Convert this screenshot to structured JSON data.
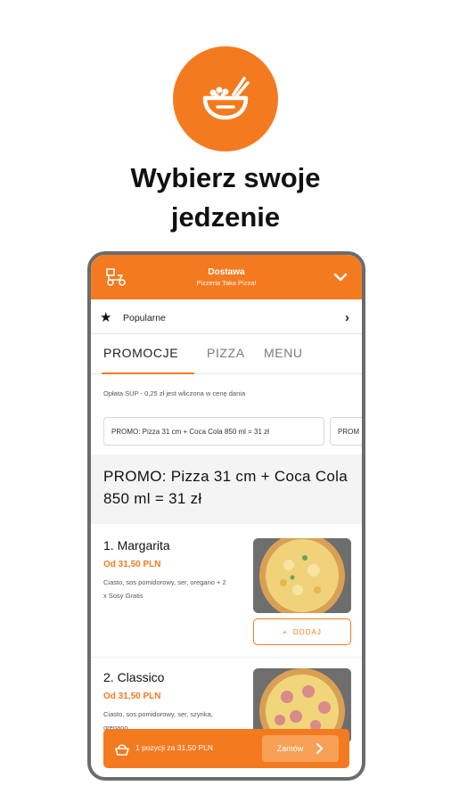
{
  "headline": {
    "line1": "Wybierz swoje",
    "line2": "jedzenie"
  },
  "colors": {
    "accent": "#F47A20"
  },
  "app": {
    "topbar": {
      "title": "Dostawa",
      "subtitle": "Pizzeria Taka Pizza!",
      "left_icon": "delivery-scooter-icon",
      "right_icon": "chevron-down-icon"
    },
    "popular": {
      "label": "Popularne",
      "icon": "star-icon",
      "arrow": "›"
    },
    "tabs": [
      {
        "label": "PROMOCJE",
        "active": true
      },
      {
        "label": "PIZZA",
        "active": false
      },
      {
        "label": "MENU",
        "active": false
      }
    ],
    "note": "Opłata SUP - 0,25 zł jest wliczona w cenę dania",
    "chips": [
      "PROMO: Pizza 31 cm + Coca Cola 850 ml = 31 zł",
      "PROM"
    ],
    "section_title": "PROMO: Pizza 31 cm + Coca Cola 850 ml = 31 zł",
    "items": [
      {
        "name": "1. Margarita",
        "price": "Od 31,50 PLN",
        "desc": "Ciasto, sos pomidorowy, ser, oregano + 2 x Sosy Gratis",
        "add_label": "DODAJ"
      },
      {
        "name": "2. Classico",
        "price": "Od 31,50 PLN",
        "desc": "Ciasto, sos pomidorowy, ser, szynka, oregano"
      }
    ],
    "cart": {
      "summary": "1 pozycji za 31,50 PLN",
      "order_label": "Zamów"
    }
  }
}
